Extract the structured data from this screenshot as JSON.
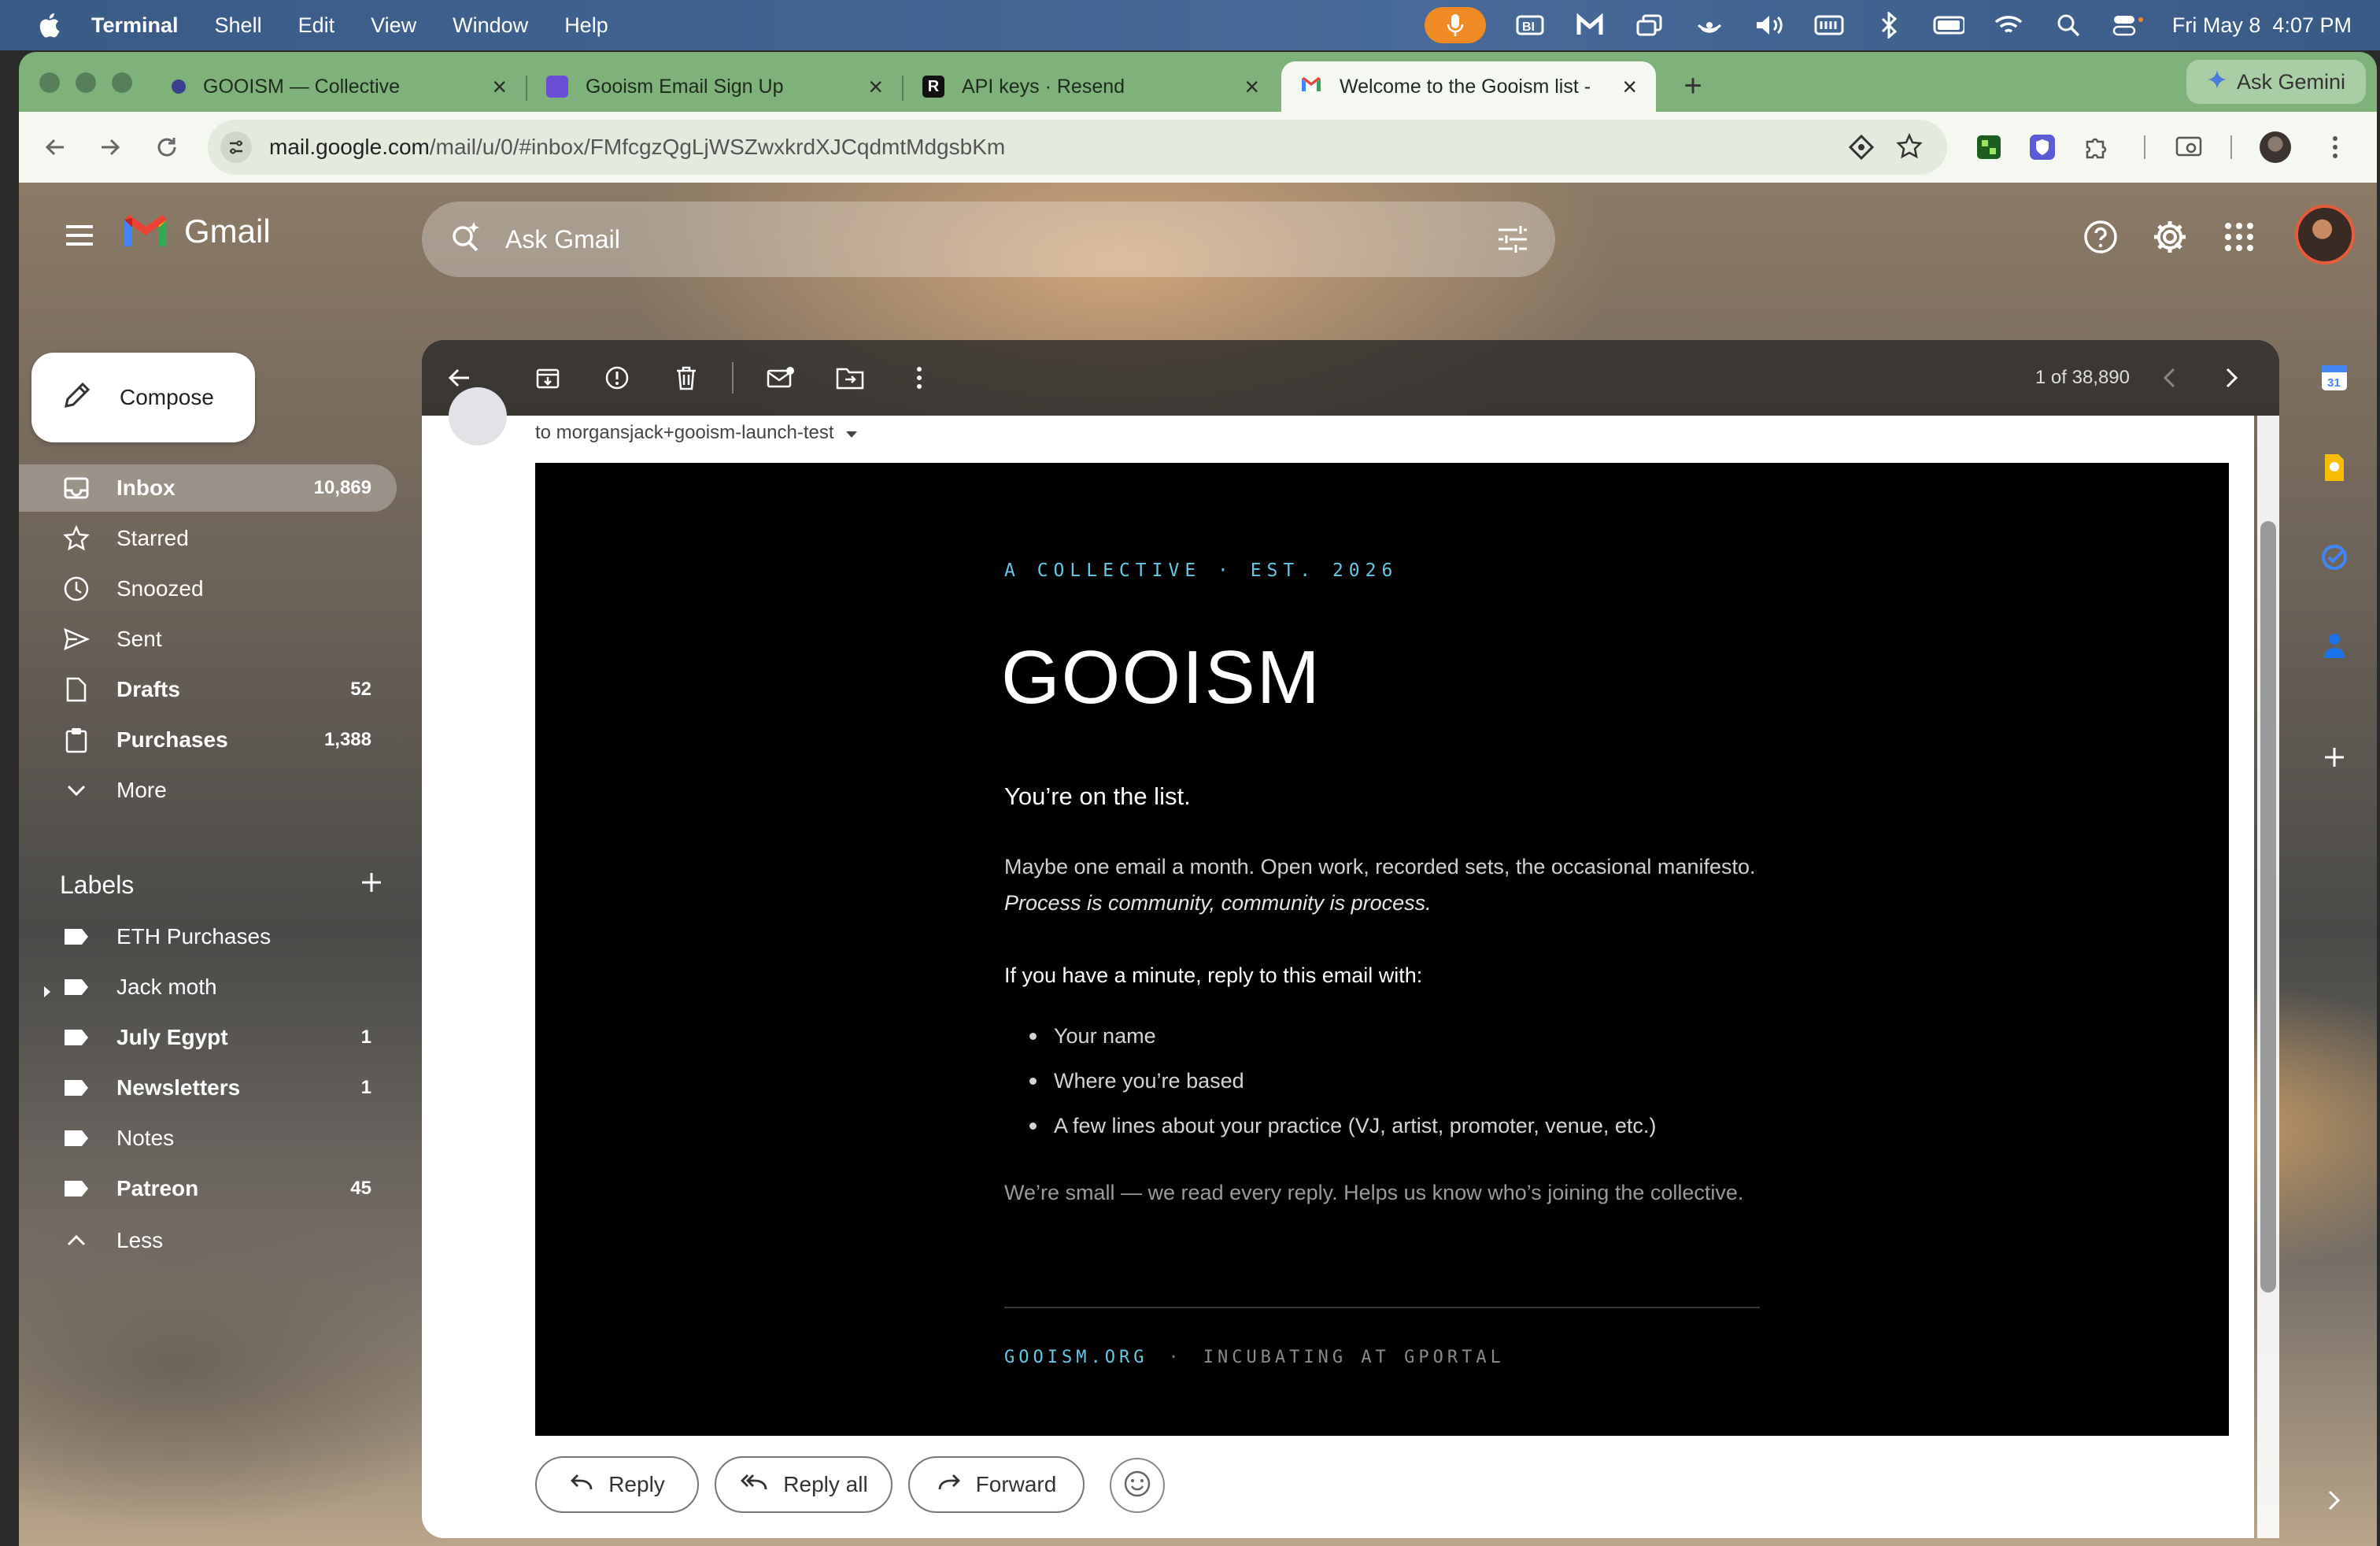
{
  "menubar": {
    "app": "Terminal",
    "menus": [
      "Shell",
      "Edit",
      "View",
      "Window",
      "Help"
    ],
    "clock": "Fri May 8  4:07 PM"
  },
  "browser": {
    "tabs": [
      {
        "title": "GOOISM — Collective",
        "favicon_color": "#3b3f8f"
      },
      {
        "title": "Gooism Email Sign Up",
        "favicon_color": "#6a4fd6"
      },
      {
        "title": "API keys · Resend",
        "favicon_color": "#111111"
      },
      {
        "title": "Welcome to the Gooism list -",
        "favicon_color": "#ea4335"
      }
    ],
    "gemini_button": "Ask Gemini",
    "url_host": "mail.google.com",
    "url_path": "/mail/u/0/#inbox/FMfcgzQgLjWSZwxkrdXJCqdmtMdgsbKm"
  },
  "gmail": {
    "product_name": "Gmail",
    "search_placeholder": "Ask Gmail",
    "compose_label": "Compose",
    "nav": [
      {
        "label": "Inbox",
        "count": "10,869",
        "icon": "inbox-icon",
        "bold": true,
        "active": true
      },
      {
        "label": "Starred",
        "count": "",
        "icon": "star-icon"
      },
      {
        "label": "Snoozed",
        "count": "",
        "icon": "clock-icon"
      },
      {
        "label": "Sent",
        "count": "",
        "icon": "send-icon"
      },
      {
        "label": "Drafts",
        "count": "52",
        "icon": "draft-icon",
        "bold": true
      },
      {
        "label": "Purchases",
        "count": "1,388",
        "icon": "purchases-icon",
        "bold": true
      },
      {
        "label": "More",
        "count": "",
        "icon": "chevron-down-icon"
      }
    ],
    "labels_heading": "Labels",
    "labels": [
      {
        "label": "ETH Purchases",
        "count": ""
      },
      {
        "label": "Jack moth",
        "count": "",
        "expandable": true
      },
      {
        "label": "July Egypt",
        "count": "1",
        "bold": true
      },
      {
        "label": "Newsletters",
        "count": "1",
        "bold": true
      },
      {
        "label": "Notes",
        "count": ""
      },
      {
        "label": "Patreon",
        "count": "45",
        "bold": true
      }
    ],
    "less_label": "Less",
    "pager": "1 of 38,890",
    "to_line": "to morgansjack+gooism-launch-test"
  },
  "email": {
    "kicker": "A COLLECTIVE · EST. 2026",
    "brand": "GOOISM",
    "headline": "You’re on the list.",
    "intro_plain": "Maybe one email a month. Open work, recorded sets, the occasional manifesto. ",
    "intro_italic": "Process is community, community is process.",
    "ask": "If you have a minute, reply to this email with:",
    "ask_items": [
      "Your name",
      "Where you’re based",
      "A few lines about your practice (VJ, artist, promoter, venue, etc.)"
    ],
    "note": "We’re small — we read every reply. Helps us know who’s joining the collective.",
    "footer_site": "GOOISM.ORG",
    "footer_sep": "·",
    "footer_incubating": "INCUBATING AT GPORTAL",
    "accent_color": "#63c9e3"
  },
  "actions": {
    "reply": "Reply",
    "reply_all": "Reply all",
    "forward": "Forward"
  }
}
